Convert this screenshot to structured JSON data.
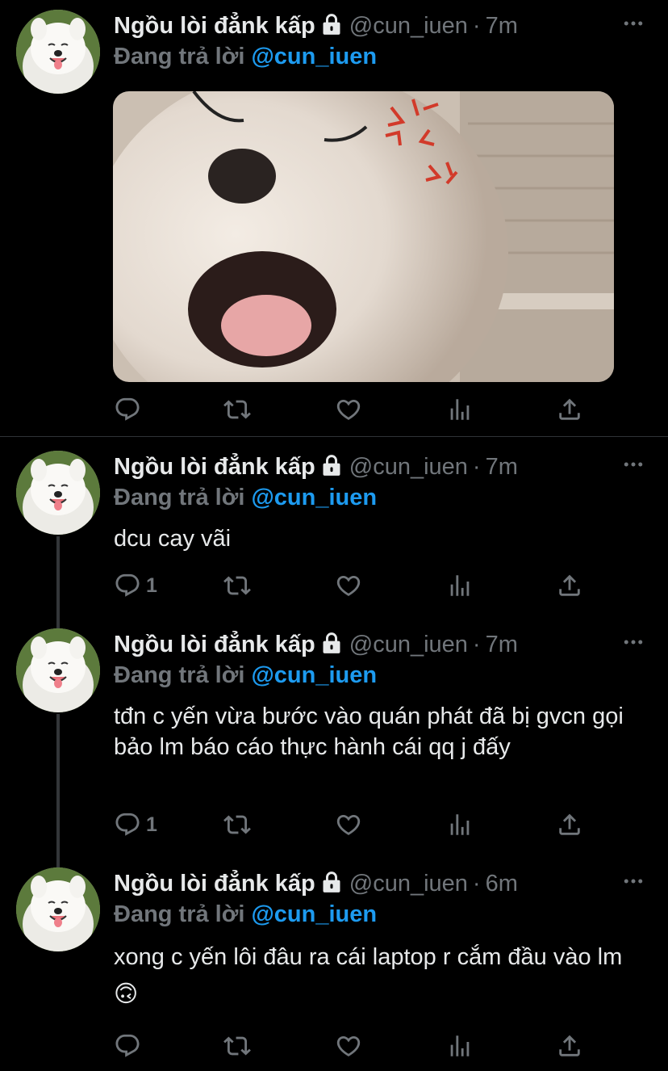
{
  "tweets": [
    {
      "name": "Ngồu lòi đẳnk kấp",
      "handle": "@cun_iuen",
      "dot": "·",
      "time": "7m",
      "replying_prefix": "Đang trả lời",
      "replying_to": "@cun_iuen",
      "text": "",
      "reply_count": ""
    },
    {
      "name": "Ngồu lòi đẳnk kấp",
      "handle": "@cun_iuen",
      "dot": "·",
      "time": "7m",
      "replying_prefix": "Đang trả lời",
      "replying_to": "@cun_iuen",
      "text": "dcu cay vãi",
      "reply_count": "1"
    },
    {
      "name": "Ngồu lòi đẳnk kấp",
      "handle": "@cun_iuen",
      "dot": "·",
      "time": "7m",
      "replying_prefix": "Đang trả lời",
      "replying_to": "@cun_iuen",
      "text": "tđn c yến vừa bước vào quán phát đã bị gvcn gọi bảo lm báo cáo thực hành cái qq j đấy",
      "reply_count": "1"
    },
    {
      "name": "Ngồu lòi đẳnk kấp",
      "handle": "@cun_iuen",
      "dot": "·",
      "time": "6m",
      "replying_prefix": "Đang trả lời",
      "replying_to": "@cun_iuen",
      "text": "xong c yến lôi đâu ra cái laptop r cắm đầu vào lm 🙃",
      "reply_count": ""
    }
  ],
  "colors": {
    "background": "#000000",
    "text": "#e7e9ea",
    "secondary": "#71767b",
    "accent": "#1d9bf0"
  },
  "icons": [
    "lock-icon",
    "more-icon",
    "reply-icon",
    "retweet-icon",
    "like-icon",
    "views-icon",
    "share-icon"
  ]
}
